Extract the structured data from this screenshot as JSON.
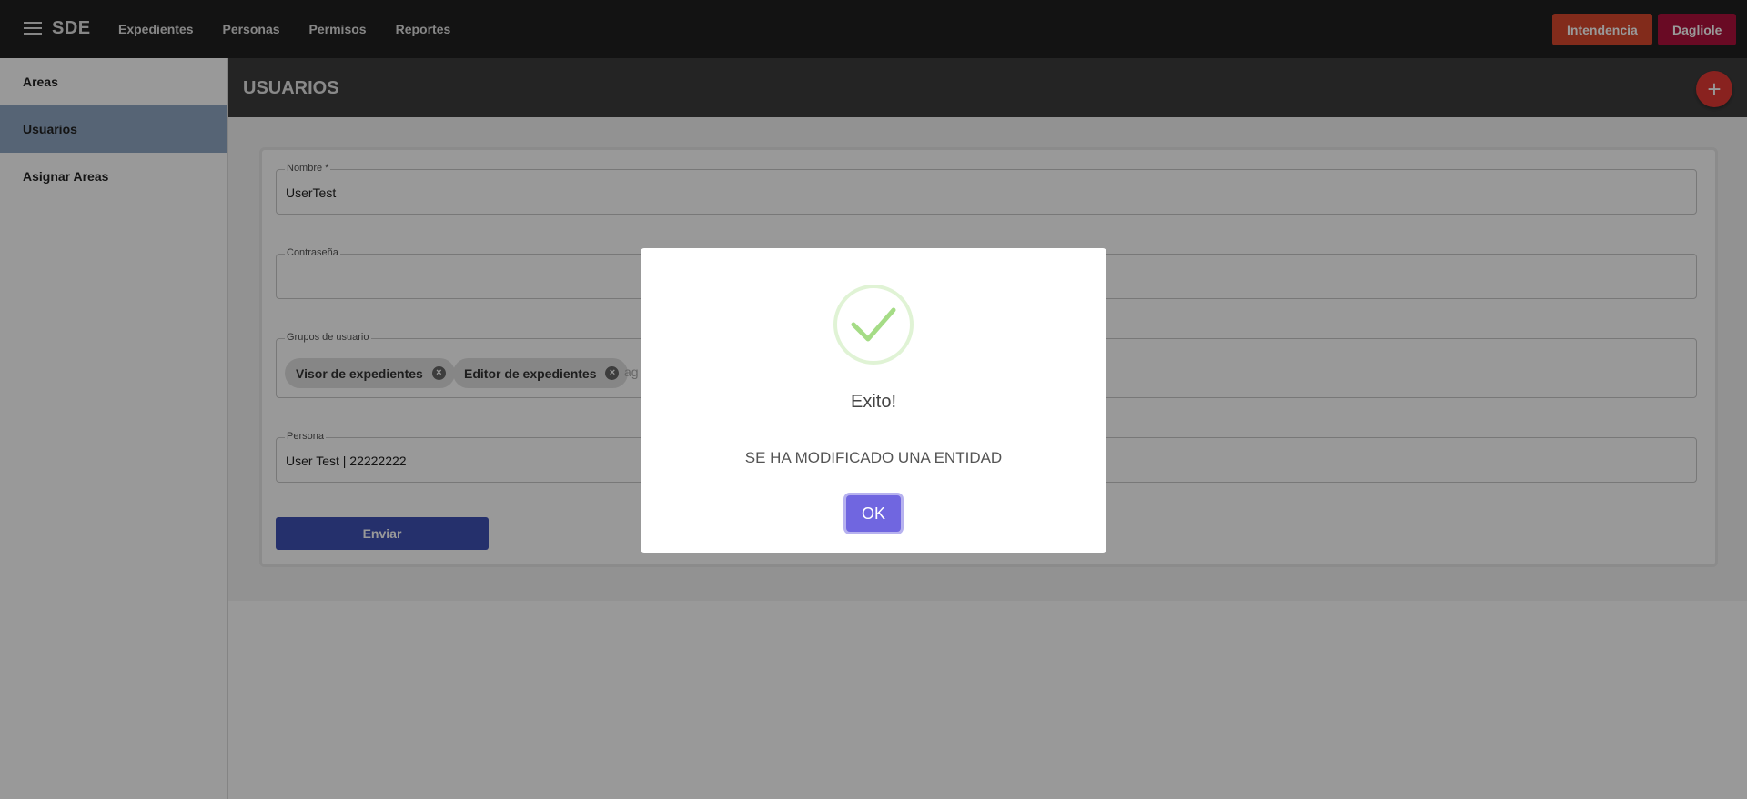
{
  "app": {
    "title": "SDE"
  },
  "nav": [
    "Expedientes",
    "Personas",
    "Permisos",
    "Reportes"
  ],
  "header_buttons": {
    "intendencia": "Intendencia",
    "user": "Dagliole"
  },
  "sidebar": {
    "items": [
      "Areas",
      "Usuarios",
      "Asignar Areas"
    ],
    "active": "Usuarios"
  },
  "page": {
    "title": "USUARIOS",
    "add_button": "+"
  },
  "form": {
    "nombre": {
      "label": "Nombre *",
      "value": "UserTest"
    },
    "password": {
      "label": "Contraseña",
      "value": ""
    },
    "grupos": {
      "label": "Grupos de usuario",
      "chips": [
        "Visor de expedientes",
        "Editor de expedientes"
      ],
      "input_partial": "ag"
    },
    "persona": {
      "label": "Persona",
      "value": "User Test | 22222222"
    },
    "submit": "Enviar"
  },
  "dialog": {
    "title": "Exito!",
    "message": "SE HA MODIFICADO UNA ENTIDAD",
    "ok": "OK",
    "icon": "success-check-icon"
  },
  "colors": {
    "topbar": "#212121",
    "intendencia": "#d9482d",
    "user_button": "#b0113c",
    "sidebar_active": "#8fa7c4",
    "submit": "#3f51b5",
    "fab": "#e53935",
    "ok_button": "#7066e0",
    "success": "#a5dc86"
  }
}
